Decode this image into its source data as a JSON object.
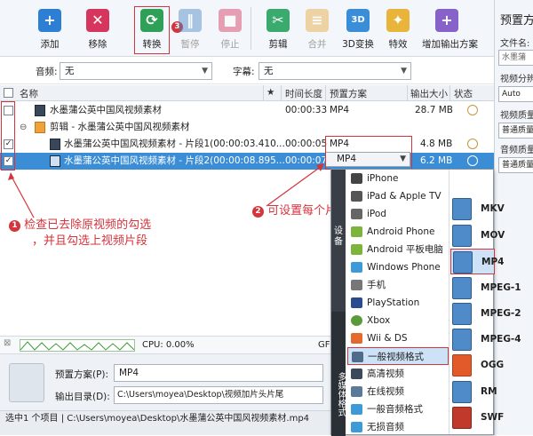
{
  "toolbar": {
    "add": "添加",
    "remove": "移除",
    "convert": "转换",
    "pause": "暂停",
    "stop": "停止",
    "cut": "剪辑",
    "merge": "合并",
    "convert3d": "3D变换",
    "effects": "特效",
    "add_output": "增加输出方案"
  },
  "right_panel": {
    "title": "预置方",
    "filename_label": "文件名:",
    "filename_value": "水墨蒲",
    "resolution_label": "视频分辨",
    "resolution_value": "Auto",
    "quality_label": "视频质量",
    "quality_value": "普通质量",
    "audio_quality_label": "音频质量",
    "audio_quality_value": "普通质量"
  },
  "filters": {
    "audio_label": "音频:",
    "audio_value": "无",
    "subtitle_label": "字幕:",
    "subtitle_value": "无"
  },
  "table": {
    "headers": {
      "name": "名称",
      "star": "★",
      "duration": "时间长度",
      "preset": "预置方案",
      "size": "输出大小",
      "status": "状态"
    },
    "rows": [
      {
        "name": "水墨蒲公英中国风视频素材",
        "duration": "00:00:33",
        "preset": "MP4",
        "size": "28.7 MB"
      },
      {
        "name": "剪辑 - 水墨蒲公英中国风视频素材"
      },
      {
        "name": "水墨蒲公英中国风视频素材 - 片段1(00:00:03.410...",
        "duration": "00:00:05",
        "preset": "MP4",
        "size": "4.8 MB"
      },
      {
        "name": "水墨蒲公英中国风视频素材 - 片段2(00:00:08.895...",
        "duration": "00:00:07",
        "preset": "MP4",
        "size": "6.2 MB"
      }
    ]
  },
  "annotations": {
    "a1_num": "1",
    "a1_line1": "检查已去除原视频的勾选",
    "a1_line2": "，并且勾选上视频片段",
    "a2_num": "2",
    "a2_text": "可设置每个片段的格式",
    "a3_num": "3"
  },
  "bottom": {
    "cpu": "CPU: 0.00%",
    "gpu_partial": "GF",
    "preset_label": "预置方案(P):",
    "preset_value": "MP4",
    "outdir_label": "输出目录(D):",
    "outdir_value": "C:\\Users\\moyea\\Desktop\\视频加片头片尾",
    "status": "选中1 个项目 | C:\\Users\\moyea\\Desktop\\水墨蒲公英中国风视频素材.mp4"
  },
  "popup": {
    "tab_device": "设备",
    "tab_media": "多媒体格式",
    "categories": [
      "iPhone",
      "iPad & Apple TV",
      "iPod",
      "Android Phone",
      "Android 平板电脑",
      "Windows Phone",
      "手机",
      "PlayStation",
      "Xbox",
      "Wii & DS",
      "一般视频格式",
      "高清视频",
      "在线视频",
      "一般音频格式",
      "无损音频"
    ],
    "formats": [
      "MKV",
      "MOV",
      "MP4",
      "MPEG-1",
      "MPEG-2",
      "MPEG-4",
      "OGG",
      "RM",
      "SWF"
    ]
  },
  "colors": {
    "accent_red": "#d4343c",
    "selected_row": "#3b8ed6",
    "add_blue": "#2d7fd3",
    "convert_green": "#2fa058"
  }
}
